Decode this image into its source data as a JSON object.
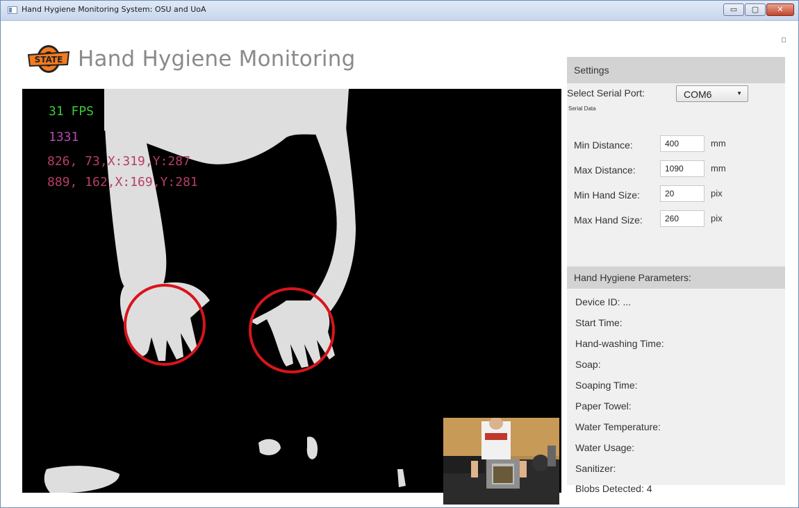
{
  "window": {
    "title": "Hand Hygiene Monitoring System: OSU and UoA",
    "buttons": {
      "minimize": "▭",
      "maximize": "▢",
      "close": "✕"
    }
  },
  "header": {
    "app_title": "Hand Hygiene Monitoring",
    "logo_text": "STATE"
  },
  "feed": {
    "overlay": {
      "fps": "31 FPS",
      "count": "1331",
      "coord1": "826, 73,X:319,Y:287",
      "coord2": "889, 162,X:169,Y:281"
    }
  },
  "settings": {
    "header": "Settings",
    "serial_port_label": "Select Serial Port:",
    "serial_port_value": "COM6",
    "serial_data_label": "Serial Data",
    "fields": [
      {
        "label": "Min Distance:",
        "value": "400",
        "unit": "mm"
      },
      {
        "label": "Max Distance:",
        "value": "1090",
        "unit": "mm"
      },
      {
        "label": "Min Hand Size:",
        "value": "20",
        "unit": "pix"
      },
      {
        "label": "Max Hand Size:",
        "value": "260",
        "unit": "pix"
      }
    ]
  },
  "parameters": {
    "header": "Hand Hygiene Parameters:",
    "items": [
      "Device ID:  ...",
      "Start Time:",
      "Hand-washing Time:",
      "Soap:",
      "Soaping Time:",
      "Paper Towel:",
      "Water Temperature:",
      "Water Usage:",
      "Sanitizer:",
      "Blobs Detected:  4"
    ]
  },
  "colors": {
    "accent_brand": "#f47b20",
    "fps_text": "#3cc93c",
    "count_text": "#b14ab1",
    "coord_text": "#b73d69",
    "hand_circle": "#d9141b"
  }
}
